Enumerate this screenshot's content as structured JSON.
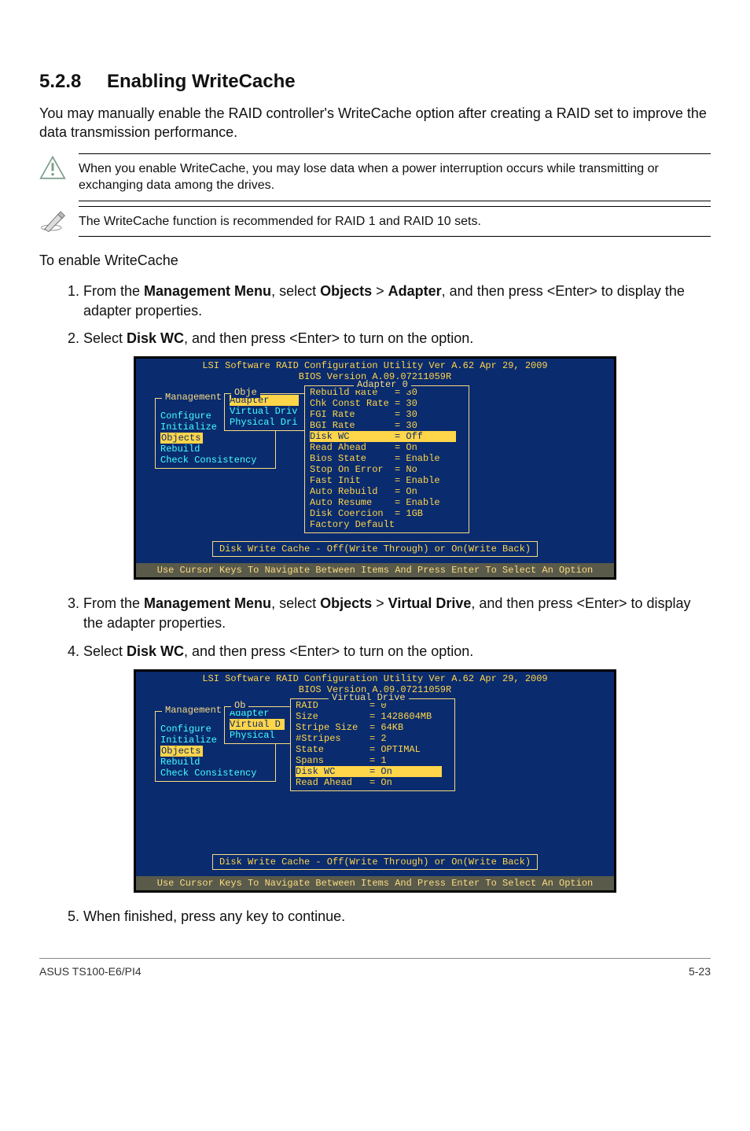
{
  "section": {
    "number": "5.2.8",
    "title": "Enabling WriteCache"
  },
  "intro": "You may manually enable the RAID controller's WriteCache option after creating a RAID set to improve the data transmission performance.",
  "note1": "When you enable WriteCache, you may lose data when a power interruption occurs while transmitting or exchanging data among the drives.",
  "note2": "The WriteCache function is recommended for RAID 1 and RAID 10 sets.",
  "subhead": "To enable WriteCache",
  "step1_pre": "From the ",
  "step1_bold1": "Management Menu",
  "step1_mid": ", select ",
  "step1_bold2": "Objects",
  "step1_gt": " > ",
  "step1_bold3": "Adapter",
  "step1_post": ", and then press <Enter> to display the adapter properties.",
  "step2_pre": "Select ",
  "step2_bold": "Disk WC",
  "step2_post": ", and then press <Enter> to turn on the option.",
  "step3_pre": "From the ",
  "step3_bold1": "Management Menu",
  "step3_mid": ", select ",
  "step3_bold2": "Objects",
  "step3_gt": " > ",
  "step3_bold3": "Virtual Drive",
  "step3_post": ", and then press <Enter> to display the adapter properties.",
  "step4_pre": "Select ",
  "step4_bold": "Disk WC",
  "step4_post": ", and then press <Enter> to turn on the option.",
  "step5": "When finished, press any key to continue.",
  "footer_left": "ASUS TS100-E6/PI4",
  "footer_right": "5-23",
  "bios": {
    "title1": "LSI Software RAID Configuration Utility Ver A.62 Apr 29, 2009",
    "title2": "BIOS Version  A.09.07211059R",
    "footer": "Use Cursor Keys To Navigate Between Items And Press Enter To Select An Option",
    "hint": "Disk Write Cache - Off(Write Through) or On(Write Back)",
    "mgmt_label": "Management",
    "obj_label_trunc1": "Obje",
    "obj_label_trunc2": "Ob",
    "mgmt_items": {
      "m0": "Configure",
      "m1": "Initialize",
      "m2": "Objects",
      "m3": "Rebuild",
      "m4": "Check Consistency"
    },
    "obj_items": {
      "o0": "Adapter",
      "o1": "Virtual Driv",
      "o2": "Physical Dri"
    },
    "obj_items2": {
      "o0": "Adapter",
      "o1": "Virtual D",
      "o2": "Physical"
    },
    "adapter0": {
      "label": "Adapter 0",
      "r": [
        {
          "k": "Rebuild Rate",
          "v": "= 30"
        },
        {
          "k": "Chk Const Rate",
          "v": "= 30"
        },
        {
          "k": "FGI Rate",
          "v": "= 30"
        },
        {
          "k": "BGI Rate",
          "v": "= 30"
        },
        {
          "k": "Disk WC",
          "v": "= Off",
          "hl": true
        },
        {
          "k": "Read Ahead",
          "v": "= On"
        },
        {
          "k": "Bios State",
          "v": "= Enable"
        },
        {
          "k": "Stop On Error",
          "v": "= No"
        },
        {
          "k": "Fast Init",
          "v": "= Enable"
        },
        {
          "k": "Auto Rebuild",
          "v": "= On"
        },
        {
          "k": "Auto Resume",
          "v": "= Enable"
        },
        {
          "k": "Disk Coercion",
          "v": "= 1GB"
        },
        {
          "k": "Factory Default",
          "v": ""
        }
      ]
    },
    "virtualdrive": {
      "label": "Virtual Drive",
      "r": [
        {
          "k": "RAID",
          "v": "= 0"
        },
        {
          "k": "Size",
          "v": "= 1428604MB"
        },
        {
          "k": "Stripe Size",
          "v": "= 64KB"
        },
        {
          "k": "#Stripes",
          "v": "= 2"
        },
        {
          "k": "State",
          "v": "= OPTIMAL"
        },
        {
          "k": "Spans",
          "v": "= 1"
        },
        {
          "k": "Disk WC",
          "v": "= On",
          "hl": true
        },
        {
          "k": "Read Ahead",
          "v": "= On"
        }
      ]
    }
  }
}
